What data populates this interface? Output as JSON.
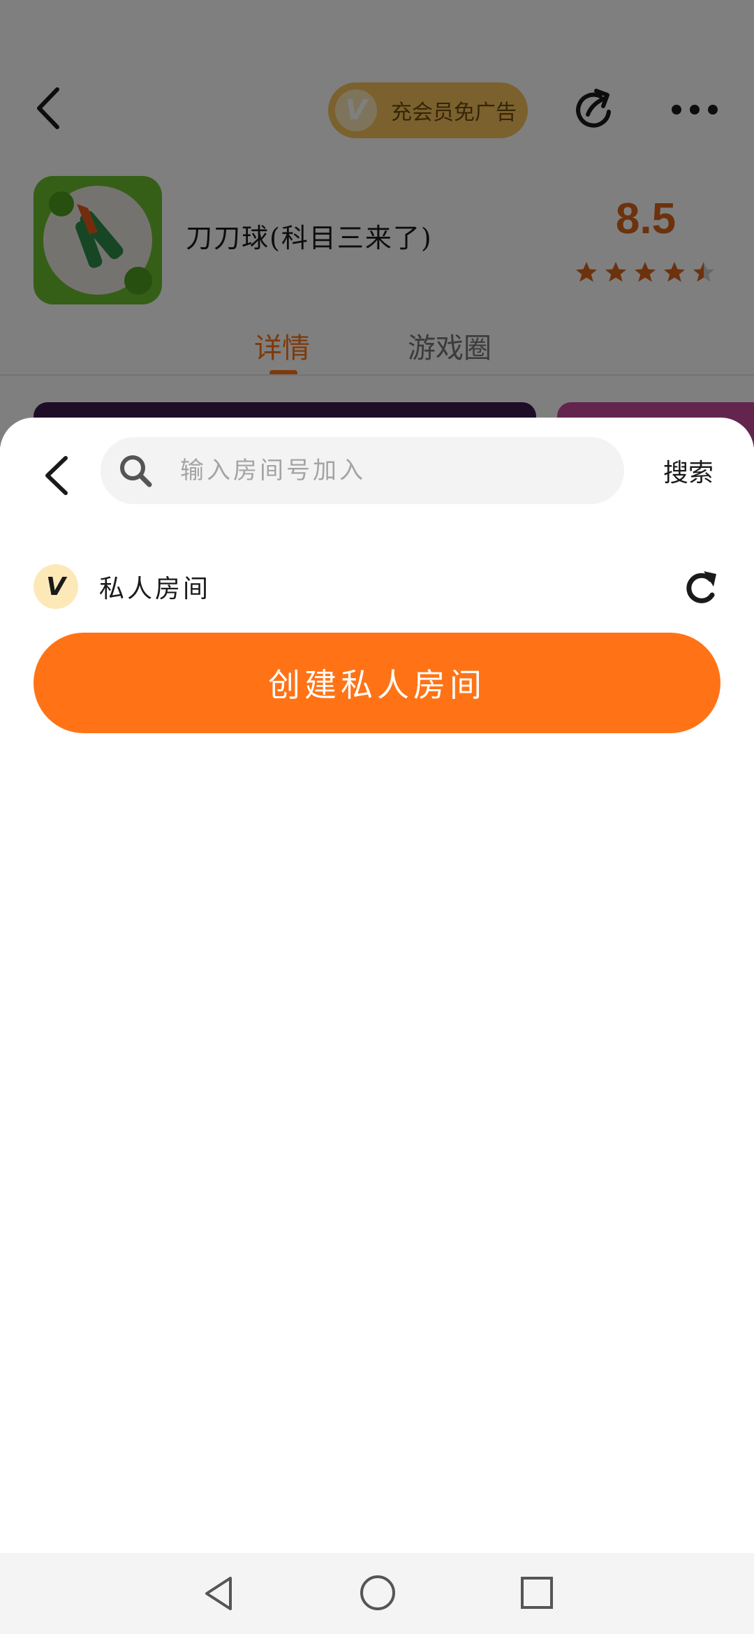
{
  "game_header": {
    "vip_badge_letter": "V",
    "vip_label": "充会员免广告",
    "game_title": "刀刀球(科目三来了)",
    "rating": "8.5",
    "stars": 4.5,
    "tabs": [
      {
        "label": "详情",
        "active": true
      },
      {
        "label": "游戏圈",
        "active": false
      }
    ]
  },
  "sheet": {
    "search": {
      "placeholder": "输入房间号加入",
      "value": "",
      "button_label": "搜索"
    },
    "private_rooms": {
      "avatar_letter": "V",
      "label": "私人房间"
    },
    "create_button_label": "创建私人房间"
  },
  "colors": {
    "accent": "#ff7316",
    "rating": "#d9651a",
    "vip": "#f7c25a"
  },
  "icons": [
    "back-arrow-icon",
    "share-icon",
    "more-icon",
    "search-icon",
    "refresh-icon",
    "nav-back-icon",
    "nav-home-icon",
    "nav-recent-icon"
  ]
}
